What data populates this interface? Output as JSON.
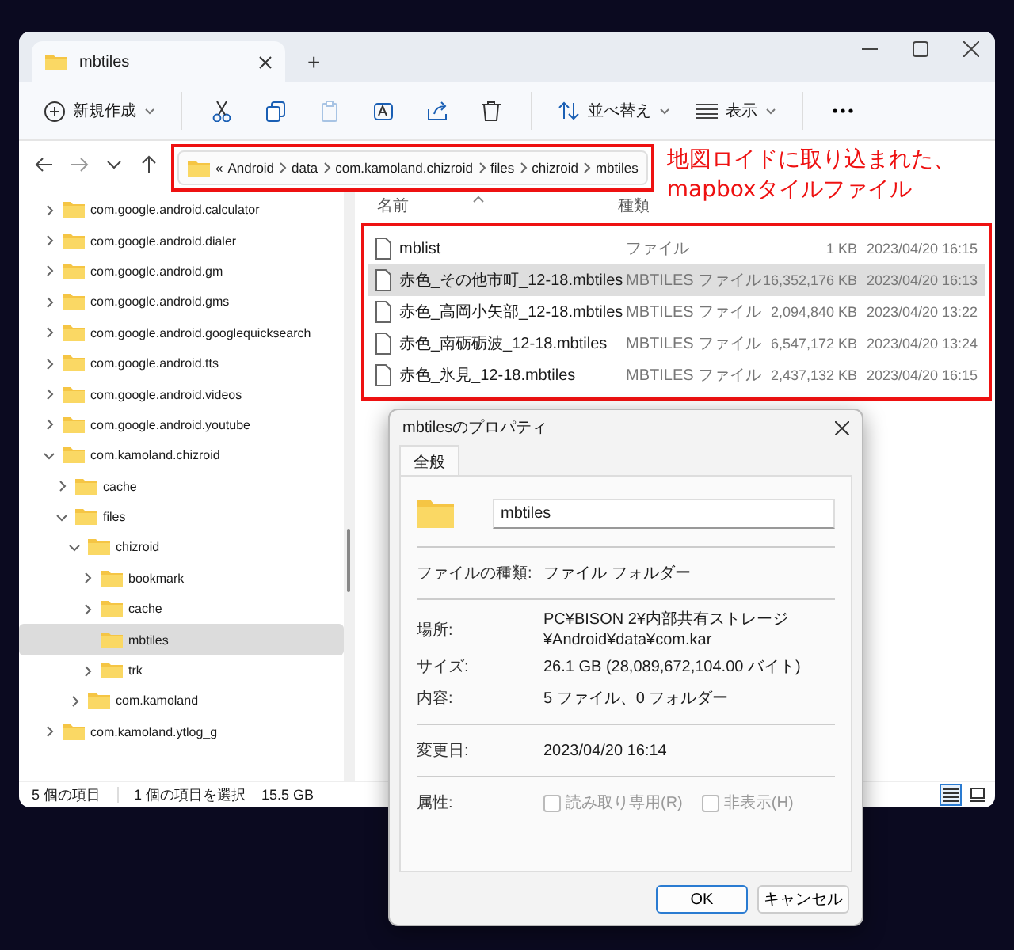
{
  "window": {
    "tab_title": "mbtiles",
    "new_tab": "+"
  },
  "toolbar": {
    "new_label": "新規作成",
    "sort_label": "並べ替え",
    "view_label": "表示"
  },
  "address": {
    "overflow": "«",
    "path": [
      "Android",
      "data",
      "com.kamoland.chizroid",
      "files",
      "chizroid",
      "mbtiles"
    ]
  },
  "annotation": {
    "lines": [
      "地図ロイドに取り込まれた、",
      "mapboxタイルファイル"
    ]
  },
  "tree": [
    {
      "label": "com.google.android.calculator",
      "has_children": true,
      "expanded": false,
      "selected": false
    },
    {
      "label": "com.google.android.dialer",
      "has_children": true,
      "expanded": false,
      "selected": false
    },
    {
      "label": "com.google.android.gm",
      "has_children": true,
      "expanded": false,
      "selected": false
    },
    {
      "label": "com.google.android.gms",
      "has_children": true,
      "expanded": false,
      "selected": false
    },
    {
      "label": "com.google.android.googlequicksearch",
      "has_children": true,
      "expanded": false,
      "selected": false
    },
    {
      "label": "com.google.android.tts",
      "has_children": true,
      "expanded": false,
      "selected": false
    },
    {
      "label": "com.google.android.videos",
      "has_children": true,
      "expanded": false,
      "selected": false
    },
    {
      "label": "com.google.android.youtube",
      "has_children": true,
      "expanded": false,
      "selected": false
    },
    {
      "label": "com.kamoland.chizroid",
      "has_children": true,
      "expanded": true,
      "selected": false,
      "children": [
        {
          "label": "cache",
          "has_children": true,
          "expanded": false,
          "selected": false
        },
        {
          "label": "files",
          "has_children": true,
          "expanded": true,
          "selected": false,
          "children": [
            {
              "label": "chizroid",
              "has_children": true,
              "expanded": true,
              "selected": false,
              "children": [
                {
                  "label": "bookmark",
                  "has_children": true,
                  "expanded": false,
                  "selected": false
                },
                {
                  "label": "cache",
                  "has_children": true,
                  "expanded": false,
                  "selected": false
                },
                {
                  "label": "mbtiles",
                  "has_children": false,
                  "expanded": false,
                  "selected": true
                },
                {
                  "label": "trk",
                  "has_children": true,
                  "expanded": false,
                  "selected": false
                }
              ]
            },
            {
              "label": "com.kamoland",
              "has_children": true,
              "expanded": false,
              "selected": false
            }
          ]
        }
      ]
    },
    {
      "label": "com.kamoland.ytlog_g",
      "has_children": true,
      "expanded": false,
      "selected": false
    }
  ],
  "file_list": {
    "columns": [
      "名前",
      "種類"
    ],
    "rows": [
      {
        "name": "mblist",
        "type": "ファイル",
        "size": "1 KB",
        "modified": "2023/04/20 16:15",
        "selected": false
      },
      {
        "name": "赤色_その他市町_12-18.mbtiles",
        "type": "MBTILES ファイル",
        "size": "16,352,176 KB",
        "modified": "2023/04/20 16:13",
        "selected": true
      },
      {
        "name": "赤色_高岡小矢部_12-18.mbtiles",
        "type": "MBTILES ファイル",
        "size": "2,094,840 KB",
        "modified": "2023/04/20 13:22",
        "selected": false
      },
      {
        "name": "赤色_南砺砺波_12-18.mbtiles",
        "type": "MBTILES ファイル",
        "size": "6,547,172 KB",
        "modified": "2023/04/20 13:24",
        "selected": false
      },
      {
        "name": "赤色_氷見_12-18.mbtiles",
        "type": "MBTILES ファイル",
        "size": "2,437,132 KB",
        "modified": "2023/04/20 16:15",
        "selected": false
      }
    ]
  },
  "status_bar": {
    "item_count": "5 個の項目",
    "selection": "1 個の項目を選択",
    "selection_size": "15.5 GB",
    "views": [
      {
        "kind": "details",
        "selected": true
      },
      {
        "kind": "tiles",
        "selected": false
      }
    ]
  },
  "dialog": {
    "title": "mbtilesのプロパティ",
    "tabs": [
      {
        "label": "全般",
        "selected": true
      }
    ],
    "name": "mbtiles",
    "sections": [
      [
        {
          "label": "ファイルの種類:",
          "value": "ファイル フォルダー"
        }
      ],
      [
        {
          "label": "場所:",
          "value": "PC¥BISON 2¥内部共有ストレージ¥Android¥data¥com.kar"
        },
        {
          "label": "サイズ:",
          "value": "26.1 GB (28,089,672,104.00 バイト)"
        },
        {
          "label": "内容:",
          "value": "5 ファイル、0 フォルダー"
        }
      ],
      [
        {
          "label": "変更日:",
          "value": "2023/04/20 16:14"
        }
      ]
    ],
    "attributes_label": "属性:",
    "attributes": [
      {
        "label": "読み取り専用(R)",
        "checked": false,
        "disabled": true
      },
      {
        "label": "非表示(H)",
        "checked": false,
        "disabled": true
      }
    ],
    "buttons": [
      {
        "label": "OK",
        "default": true
      },
      {
        "label": "キャンセル",
        "default": false
      }
    ]
  }
}
